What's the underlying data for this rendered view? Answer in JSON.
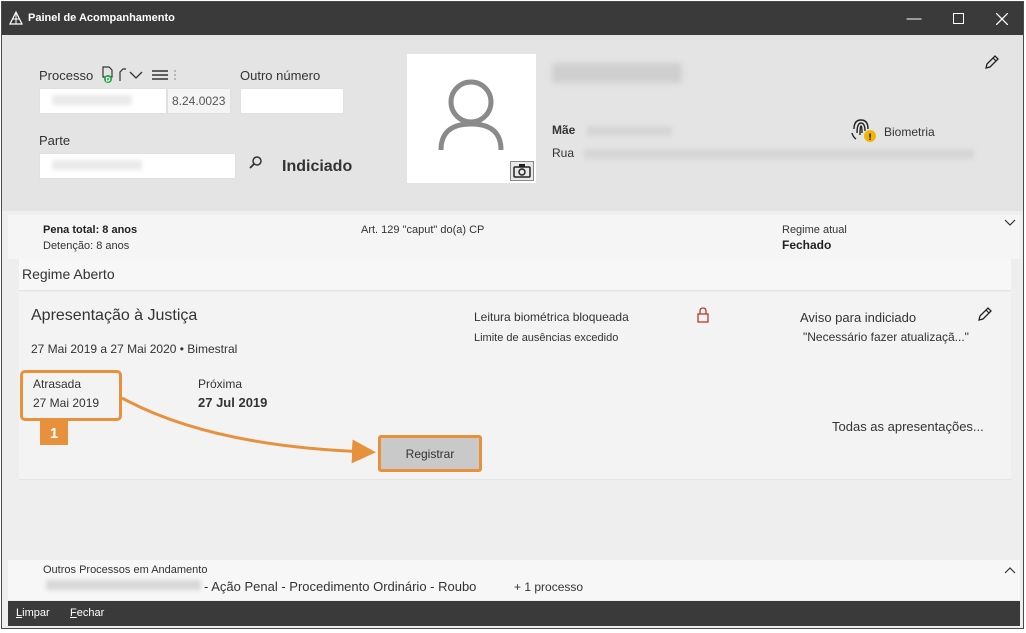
{
  "window": {
    "title": "Painel de Acompanhamento",
    "min_glyph": "—",
    "max_glyph": "☐",
    "close_glyph": "✕"
  },
  "header": {
    "processo_label": "Processo",
    "processo_suffix": "8.24.0023",
    "outro_numero_label": "Outro número",
    "parte_label": "Parte",
    "indiciado_label": "Indiciado",
    "mae_label": "Mãe",
    "rua_label": "Rua",
    "biometria_label": "Biometria"
  },
  "summary": {
    "pena_total": "Pena total: 8 anos",
    "detencao": "Detenção: 8 anos",
    "artigo": "Art. 129 \"caput\" do(a) CP",
    "regime_atual_label": "Regime atual",
    "regime_atual_value": "Fechado"
  },
  "regime": {
    "title": "Regime Aberto",
    "card_title": "Apresentação à Justiça",
    "period": "27 Mai 2019 a 27 Mai 2020 • Bimestral",
    "leitura_bloqueada": "Leitura biométrica bloqueada",
    "limite_ausencias": "Limite de ausências excedido",
    "aviso_label": "Aviso para indiciado",
    "aviso_text": "\"Necessário fazer atualizaçã...\"",
    "atrasada_label": "Atrasada",
    "atrasada_date": "27 Mai 2019",
    "proxima_label": "Próxima",
    "proxima_date": "27 Jul 2019",
    "todas_link": "Todas as apresentações...",
    "registrar_button": "Registrar",
    "step_number": "1"
  },
  "others": {
    "title": "Outros Processos em Andamento",
    "description": "- Ação Penal - Procedimento Ordinário - Roubo",
    "more": "+ 1 processo"
  },
  "bottom": {
    "limpar_u": "L",
    "limpar_rest": "impar",
    "fechar_u": "F",
    "fechar_rest": "echar"
  },
  "colors": {
    "accent": "#e8913c",
    "titlebar": "#3a3a3a",
    "lock": "#c0392b"
  }
}
